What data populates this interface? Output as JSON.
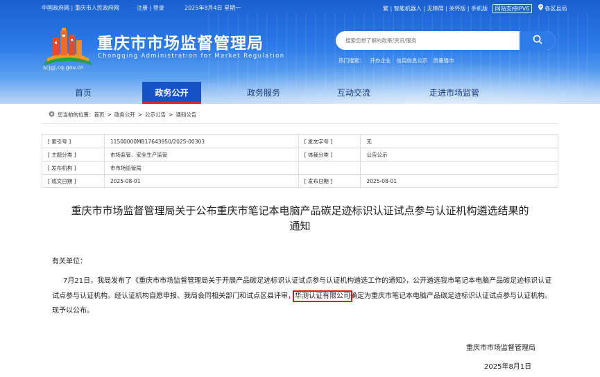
{
  "topbar": {
    "gov_link": "中国政府网",
    "cq_link": "重庆市人民政府网",
    "register": "注册",
    "login": "登录",
    "date": "2025年8月4日 星期一",
    "trad": "繁",
    "robot": "智能机器人",
    "accessible": "无障碍",
    "elderly": "关怀版",
    "mobile": "手机版",
    "ipv6": "网站支持IPV6",
    "region": "各区县局"
  },
  "site": {
    "title": "重庆市市场监督管理局",
    "title_en": "Chongqing  Administration for Market Regulation",
    "url": "scjgj.cq.gov.cn"
  },
  "search": {
    "placeholder": "搜索您想了解的政策/资讯/服务",
    "hot_label": "热门搜索：",
    "hot_items": [
      "开办企业",
      "信用信息公示",
      "质量强市"
    ]
  },
  "nav": [
    "首页",
    "政务公开",
    "政务服务",
    "互动交流",
    "走进市场监管"
  ],
  "breadcrumb": {
    "prefix": "您当前的位置：",
    "items": [
      "首页",
      "政务公开",
      "公示公告",
      "通知公告"
    ]
  },
  "meta": {
    "index_label": "[ 索引号 ]",
    "index_value": "11500000MB17643950/2025-00303",
    "docno_label": "[ 发文字号 ]",
    "docno_value": "无",
    "topic_label": "[ 主题分类 ]",
    "topic_value": "市场监管、安全生产监管",
    "genre_label": "[ 体裁分类 ]",
    "genre_value": "公告公示",
    "org_label": "[ 发布机构 ]",
    "org_value": "市市场监管局",
    "created_label": "[ 成文日期 ]",
    "created_value": "2025-08-01",
    "published_label": "[ 发布日期 ]",
    "published_value": "2025-08-01"
  },
  "article": {
    "title_line1": "重庆市市场监督管理局关于公布重庆市笔记本电脑产品碳足迹标识认证试点参与认证机构遴选结果的",
    "title_line2": "通知",
    "greeting": "有关单位：",
    "para_before": "7月21日，我局发布了《重庆市市场监督管理局关于开展产品碳足迹标识认证试点参与认证机构遴选工作的通知》，公开遴选我市笔记本电脑产品碳足迹标识认证试点参与认证机构。经认证机构自愿申报、我局会同相关部门和试点区县评审，",
    "highlight": "华测认证有限公司",
    "para_after": "确定为重庆市笔记本电脑产品碳足迹标识认证试点参与认证机构。现予以公布。",
    "signature": "重庆市市场监督管理局",
    "sign_date": "2025年8月1日"
  },
  "colors": {
    "nav_active": "#1553c7",
    "accent_red": "#e0141b",
    "search_button": "#2f7be9"
  }
}
